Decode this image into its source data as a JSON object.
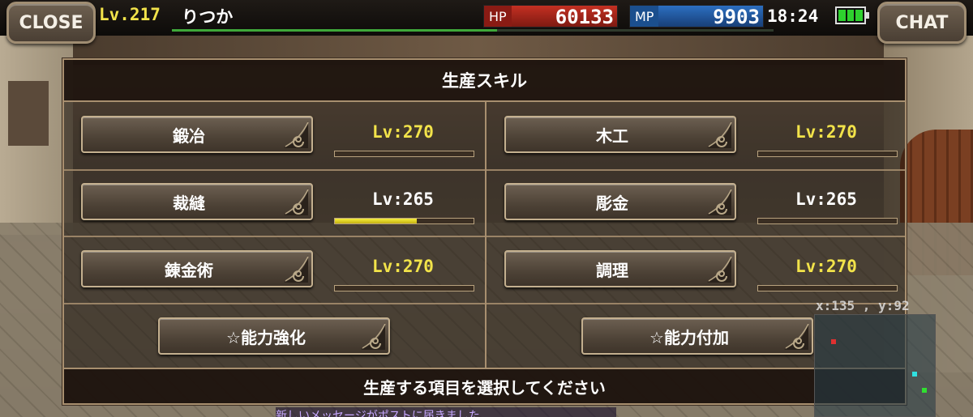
{
  "header": {
    "close_label": "CLOSE",
    "chat_label": "CHAT",
    "level": "Lv.217",
    "player_name": "りつか",
    "exp_progress": 0.54,
    "hp_label": "HP",
    "hp_value": "60133",
    "mp_label": "MP",
    "mp_value": "9903",
    "clock": "18:24",
    "battery_level": 1.0
  },
  "panel": {
    "title": "生産スキル",
    "footer": "生産する項目を選択してください",
    "skills": [
      {
        "name": "鍛冶",
        "level": "Lv:270",
        "maxed": true,
        "progress": 0
      },
      {
        "name": "木工",
        "level": "Lv:270",
        "maxed": true,
        "progress": 0
      },
      {
        "name": "裁縫",
        "level": "Lv:265",
        "maxed": false,
        "progress": 0.59
      },
      {
        "name": "彫金",
        "level": "Lv:265",
        "maxed": false,
        "progress": 0
      },
      {
        "name": "錬金術",
        "level": "Lv:270",
        "maxed": true,
        "progress": 0
      },
      {
        "name": "調理",
        "level": "Lv:270",
        "maxed": true,
        "progress": 0
      }
    ],
    "specials": [
      {
        "name": "☆能力強化"
      },
      {
        "name": "☆能力付加"
      }
    ]
  },
  "overlay": {
    "coords_text": "x:135 , y:92",
    "chatlog_text": "新しいメッセージがポストに届きました"
  },
  "colors": {
    "maxed_level": "#f2e34a",
    "normal_level": "#ffffff",
    "hp": "#c43022",
    "mp": "#2c6fc0",
    "frame": "#a88f6f"
  },
  "icons": [
    "swirl-ornament-icon",
    "battery-icon"
  ]
}
